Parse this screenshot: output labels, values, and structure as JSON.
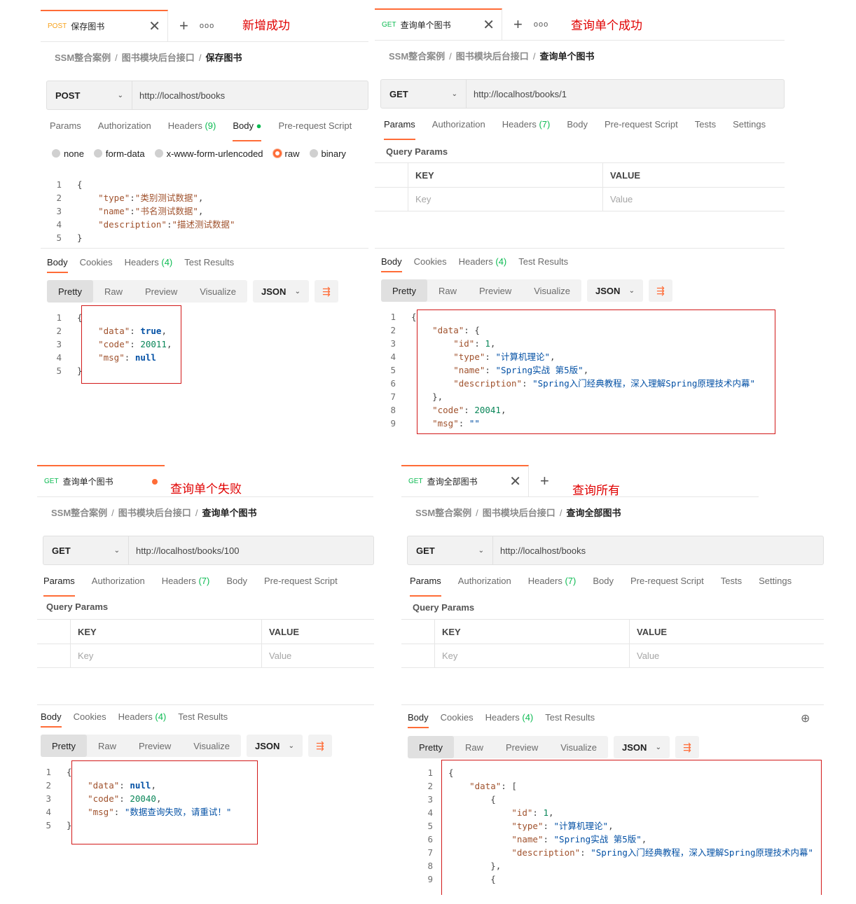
{
  "panels": {
    "p1": {
      "method": "POST",
      "tab_name": "保存图书",
      "note": "新增成功",
      "crumb": [
        "SSM整合案例",
        "图书模块后台接口",
        "保存图书"
      ],
      "method_select": "POST",
      "url": "http://localhost/books",
      "req_tabs": [
        "Params",
        "Authorization",
        "Headers",
        "(9)",
        "Body",
        "Pre-request Script"
      ],
      "radios": [
        "none",
        "form-data",
        "x-www-form-urlencoded",
        "raw",
        "binary"
      ],
      "resp_tabs": [
        "Body",
        "Cookies",
        "Headers",
        "(4)",
        "Test Results"
      ],
      "views": [
        "Pretty",
        "Raw",
        "Preview",
        "Visualize"
      ],
      "format": "JSON"
    },
    "p2": {
      "method": "GET",
      "tab_name": "查询单个图书",
      "note": "查询单个成功",
      "crumb": [
        "SSM整合案例",
        "图书模块后台接口",
        "查询单个图书"
      ],
      "method_select": "GET",
      "url": "http://localhost/books/1",
      "req_tabs": [
        "Params",
        "Authorization",
        "Headers",
        "(7)",
        "Body",
        "Pre-request Script",
        "Tests",
        "Settings"
      ],
      "query_params": "Query Params",
      "kv": {
        "key": "KEY",
        "value": "VALUE",
        "key_ph": "Key",
        "value_ph": "Value"
      },
      "resp_tabs": [
        "Body",
        "Cookies",
        "Headers",
        "(4)",
        "Test Results"
      ],
      "views": [
        "Pretty",
        "Raw",
        "Preview",
        "Visualize"
      ],
      "format": "JSON"
    },
    "p3": {
      "method": "GET",
      "tab_name": "查询单个图书",
      "note": "查询单个失败",
      "crumb": [
        "SSM整合案例",
        "图书模块后台接口",
        "查询单个图书"
      ],
      "method_select": "GET",
      "url": "http://localhost/books/100",
      "req_tabs": [
        "Params",
        "Authorization",
        "Headers",
        "(7)",
        "Body",
        "Pre-request Script"
      ],
      "query_params": "Query Params",
      "kv": {
        "key": "KEY",
        "value": "VALUE",
        "key_ph": "Key",
        "value_ph": "Value"
      },
      "resp_tabs": [
        "Body",
        "Cookies",
        "Headers",
        "(4)",
        "Test Results"
      ],
      "views": [
        "Pretty",
        "Raw",
        "Preview",
        "Visualize"
      ],
      "format": "JSON"
    },
    "p4": {
      "method": "GET",
      "tab_name": "查询全部图书",
      "note": "查询所有",
      "crumb": [
        "SSM整合案例",
        "图书模块后台接口",
        "查询全部图书"
      ],
      "method_select": "GET",
      "url": "http://localhost/books",
      "req_tabs": [
        "Params",
        "Authorization",
        "Headers",
        "(7)",
        "Body",
        "Pre-request Script",
        "Tests",
        "Settings"
      ],
      "query_params": "Query Params",
      "kv": {
        "key": "KEY",
        "value": "VALUE",
        "key_ph": "Key",
        "value_ph": "Value"
      },
      "resp_tabs": [
        "Body",
        "Cookies",
        "Headers",
        "(4)",
        "Test Results"
      ],
      "views": [
        "Pretty",
        "Raw",
        "Preview",
        "Visualize"
      ],
      "format": "JSON"
    }
  },
  "code": {
    "p1_req": [
      {
        "n": "1",
        "t": [
          {
            "c": "punc",
            "s": "{"
          }
        ]
      },
      {
        "n": "2",
        "t": [
          {
            "c": "punc",
            "s": "    "
          },
          {
            "c": "skey",
            "s": "\"type\""
          },
          {
            "c": "punc",
            "s": ":"
          },
          {
            "c": "skey",
            "s": "\"类别测试数据\""
          },
          {
            "c": "punc",
            "s": ","
          }
        ]
      },
      {
        "n": "3",
        "t": [
          {
            "c": "punc",
            "s": "    "
          },
          {
            "c": "skey",
            "s": "\"name\""
          },
          {
            "c": "punc",
            "s": ":"
          },
          {
            "c": "skey",
            "s": "\"书名测试数据\""
          },
          {
            "c": "punc",
            "s": ","
          }
        ]
      },
      {
        "n": "4",
        "t": [
          {
            "c": "punc",
            "s": "    "
          },
          {
            "c": "skey",
            "s": "\"description\""
          },
          {
            "c": "punc",
            "s": ":"
          },
          {
            "c": "skey",
            "s": "\"描述测试数据\""
          }
        ]
      },
      {
        "n": "5",
        "t": [
          {
            "c": "punc",
            "s": "}"
          }
        ]
      }
    ],
    "p1_resp": [
      {
        "n": "1",
        "t": [
          {
            "c": "punc",
            "s": "{"
          }
        ]
      },
      {
        "n": "2",
        "t": [
          {
            "c": "punc",
            "s": "    "
          },
          {
            "c": "skey",
            "s": "\"data\""
          },
          {
            "c": "punc",
            "s": ": "
          },
          {
            "c": "kw",
            "s": "true"
          },
          {
            "c": "punc",
            "s": ","
          }
        ]
      },
      {
        "n": "3",
        "t": [
          {
            "c": "punc",
            "s": "    "
          },
          {
            "c": "skey",
            "s": "\"code\""
          },
          {
            "c": "punc",
            "s": ": "
          },
          {
            "c": "num",
            "s": "20011"
          },
          {
            "c": "punc",
            "s": ","
          }
        ]
      },
      {
        "n": "4",
        "t": [
          {
            "c": "punc",
            "s": "    "
          },
          {
            "c": "skey",
            "s": "\"msg\""
          },
          {
            "c": "punc",
            "s": ": "
          },
          {
            "c": "kw",
            "s": "null"
          }
        ]
      },
      {
        "n": "5",
        "t": [
          {
            "c": "punc",
            "s": "}"
          }
        ]
      }
    ],
    "p2_resp": [
      {
        "n": "1",
        "t": [
          {
            "c": "punc",
            "s": "{"
          }
        ]
      },
      {
        "n": "2",
        "t": [
          {
            "c": "punc",
            "s": "    "
          },
          {
            "c": "skey",
            "s": "\"data\""
          },
          {
            "c": "punc",
            "s": ": {"
          }
        ]
      },
      {
        "n": "3",
        "t": [
          {
            "c": "punc",
            "s": "        "
          },
          {
            "c": "skey",
            "s": "\"id\""
          },
          {
            "c": "punc",
            "s": ": "
          },
          {
            "c": "num",
            "s": "1"
          },
          {
            "c": "punc",
            "s": ","
          }
        ]
      },
      {
        "n": "4",
        "t": [
          {
            "c": "punc",
            "s": "        "
          },
          {
            "c": "skey",
            "s": "\"type\""
          },
          {
            "c": "punc",
            "s": ": "
          },
          {
            "c": "sval",
            "s": "\"计算机理论\""
          },
          {
            "c": "punc",
            "s": ","
          }
        ]
      },
      {
        "n": "5",
        "t": [
          {
            "c": "punc",
            "s": "        "
          },
          {
            "c": "skey",
            "s": "\"name\""
          },
          {
            "c": "punc",
            "s": ": "
          },
          {
            "c": "sval",
            "s": "\"Spring实战 第5版\""
          },
          {
            "c": "punc",
            "s": ","
          }
        ]
      },
      {
        "n": "6",
        "t": [
          {
            "c": "punc",
            "s": "        "
          },
          {
            "c": "skey",
            "s": "\"description\""
          },
          {
            "c": "punc",
            "s": ": "
          },
          {
            "c": "sval",
            "s": "\"Spring入门经典教程，深入理解Spring原理技术内幕\""
          }
        ]
      },
      {
        "n": "7",
        "t": [
          {
            "c": "punc",
            "s": "    },"
          }
        ]
      },
      {
        "n": "8",
        "t": [
          {
            "c": "punc",
            "s": "    "
          },
          {
            "c": "skey",
            "s": "\"code\""
          },
          {
            "c": "punc",
            "s": ": "
          },
          {
            "c": "num",
            "s": "20041"
          },
          {
            "c": "punc",
            "s": ","
          }
        ]
      },
      {
        "n": "9",
        "t": [
          {
            "c": "punc",
            "s": "    "
          },
          {
            "c": "skey",
            "s": "\"msg\""
          },
          {
            "c": "punc",
            "s": ": "
          },
          {
            "c": "sval",
            "s": "\"\""
          }
        ]
      }
    ],
    "p3_resp": [
      {
        "n": "1",
        "t": [
          {
            "c": "punc",
            "s": "{"
          }
        ]
      },
      {
        "n": "2",
        "t": [
          {
            "c": "punc",
            "s": "    "
          },
          {
            "c": "skey",
            "s": "\"data\""
          },
          {
            "c": "punc",
            "s": ": "
          },
          {
            "c": "kw",
            "s": "null"
          },
          {
            "c": "punc",
            "s": ","
          }
        ]
      },
      {
        "n": "3",
        "t": [
          {
            "c": "punc",
            "s": "    "
          },
          {
            "c": "skey",
            "s": "\"code\""
          },
          {
            "c": "punc",
            "s": ": "
          },
          {
            "c": "num",
            "s": "20040"
          },
          {
            "c": "punc",
            "s": ","
          }
        ]
      },
      {
        "n": "4",
        "t": [
          {
            "c": "punc",
            "s": "    "
          },
          {
            "c": "skey",
            "s": "\"msg\""
          },
          {
            "c": "punc",
            "s": ": "
          },
          {
            "c": "sval",
            "s": "\"数据查询失败，请重试！\""
          }
        ]
      },
      {
        "n": "5",
        "t": [
          {
            "c": "punc",
            "s": "}"
          }
        ]
      }
    ],
    "p4_resp": [
      {
        "n": "1",
        "t": [
          {
            "c": "punc",
            "s": "{"
          }
        ]
      },
      {
        "n": "2",
        "t": [
          {
            "c": "punc",
            "s": "    "
          },
          {
            "c": "skey",
            "s": "\"data\""
          },
          {
            "c": "punc",
            "s": ": ["
          }
        ]
      },
      {
        "n": "3",
        "t": [
          {
            "c": "punc",
            "s": "        {"
          }
        ]
      },
      {
        "n": "4",
        "t": [
          {
            "c": "punc",
            "s": "            "
          },
          {
            "c": "skey",
            "s": "\"id\""
          },
          {
            "c": "punc",
            "s": ": "
          },
          {
            "c": "num",
            "s": "1"
          },
          {
            "c": "punc",
            "s": ","
          }
        ]
      },
      {
        "n": "5",
        "t": [
          {
            "c": "punc",
            "s": "            "
          },
          {
            "c": "skey",
            "s": "\"type\""
          },
          {
            "c": "punc",
            "s": ": "
          },
          {
            "c": "sval",
            "s": "\"计算机理论\""
          },
          {
            "c": "punc",
            "s": ","
          }
        ]
      },
      {
        "n": "6",
        "t": [
          {
            "c": "punc",
            "s": "            "
          },
          {
            "c": "skey",
            "s": "\"name\""
          },
          {
            "c": "punc",
            "s": ": "
          },
          {
            "c": "sval",
            "s": "\"Spring实战 第5版\""
          },
          {
            "c": "punc",
            "s": ","
          }
        ]
      },
      {
        "n": "7",
        "t": [
          {
            "c": "punc",
            "s": "            "
          },
          {
            "c": "skey",
            "s": "\"description\""
          },
          {
            "c": "punc",
            "s": ": "
          },
          {
            "c": "sval",
            "s": "\"Spring入门经典教程，深入理解Spring原理技术内幕\""
          }
        ]
      },
      {
        "n": "8",
        "t": [
          {
            "c": "punc",
            "s": "        },"
          }
        ]
      },
      {
        "n": "9",
        "t": [
          {
            "c": "punc",
            "s": "        {"
          }
        ]
      }
    ]
  },
  "colors": {
    "accent": "#ff6c37",
    "annotation": "#e00000",
    "box": "#d21919",
    "post": "#f7a11a",
    "get": "#0cbb52"
  }
}
